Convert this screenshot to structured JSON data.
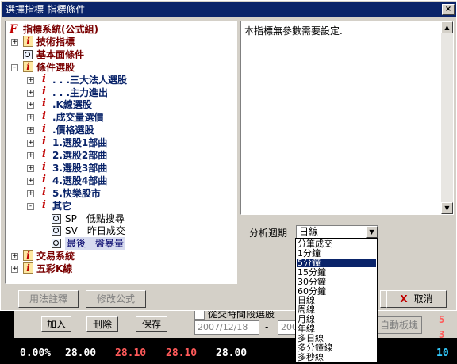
{
  "window": {
    "title": "選擇指標-指標條件"
  },
  "tree": [
    {
      "label": "指標系統(公式組)",
      "icon": "f-icon",
      "style": "red",
      "expander": ""
    },
    {
      "label": "技術指標",
      "icon": "i-box-icon",
      "style": "red",
      "expander": "+"
    },
    {
      "label": "基本面條件",
      "icon": "magnifier-icon",
      "style": "red",
      "expander": ""
    },
    {
      "label": "條件選股",
      "icon": "i-box-icon",
      "style": "red",
      "expander": "-"
    },
    {
      "label": ". . .三大法人選股",
      "icon": "i-icon",
      "style": "blue",
      "expander": "+"
    },
    {
      "label": ". . .主力進出",
      "icon": "i-icon",
      "style": "blue",
      "expander": "+"
    },
    {
      "label": ".K線選股",
      "icon": "i-icon",
      "style": "blue",
      "expander": "+"
    },
    {
      "label": ".成交量選價",
      "icon": "i-icon",
      "style": "blue",
      "expander": "+"
    },
    {
      "label": ".價格選股",
      "icon": "i-icon",
      "style": "blue",
      "expander": "+"
    },
    {
      "label": "1.選股1部曲",
      "icon": "i-icon",
      "style": "blue",
      "expander": "+"
    },
    {
      "label": "2.選股2部曲",
      "icon": "i-icon",
      "style": "blue",
      "expander": "+"
    },
    {
      "label": "3.選股3部曲",
      "icon": "i-icon",
      "style": "blue",
      "expander": "+"
    },
    {
      "label": "4.選股4部曲",
      "icon": "i-icon",
      "style": "blue",
      "expander": "+"
    },
    {
      "label": "5.快樂股市",
      "icon": "i-icon",
      "style": "blue",
      "expander": "+"
    },
    {
      "label": "其它",
      "icon": "i-icon",
      "style": "blue",
      "expander": "-"
    },
    {
      "label": "SP　低點搜尋",
      "icon": "magnifier-icon",
      "style": "plain",
      "expander": ""
    },
    {
      "label": "SV　昨日成交",
      "icon": "magnifier-icon",
      "style": "plain",
      "expander": ""
    },
    {
      "label": "最後一盤暴量",
      "icon": "magnifier-icon",
      "style": "selected",
      "expander": ""
    },
    {
      "label": "交易系統",
      "icon": "i-box-icon",
      "style": "red",
      "expander": "+"
    },
    {
      "label": "五彩K線",
      "icon": "i-box-icon",
      "style": "red",
      "expander": "+"
    }
  ],
  "description": {
    "text": "本指標無參數需要設定."
  },
  "period": {
    "label": "分析週期",
    "selected": "日線",
    "options": [
      "分筆成交",
      "1分鐘",
      "5分鐘",
      "15分鐘",
      "30分鐘",
      "60分鐘",
      "日線",
      "周線",
      "月線",
      "年線",
      "多日線",
      "多分鐘線",
      "多秒線"
    ],
    "highlighted_index": 2
  },
  "buttons": {
    "usage": "用法註釋",
    "edit_formula": "修改公式",
    "cancel": "取消",
    "cancel_icon": "X"
  },
  "background": {
    "add": "加入",
    "remove": "刪除",
    "save": "保存",
    "checkbox_label": "從交時間段選股",
    "start_date": "2007/12/18",
    "dash": "-",
    "end_date": "200",
    "auto_board": "自動板塊",
    "side_values": [
      "5",
      "3"
    ],
    "stock_row": [
      "0.00%",
      "28.00",
      "28.10",
      "28.10",
      "28.00",
      "10"
    ]
  }
}
